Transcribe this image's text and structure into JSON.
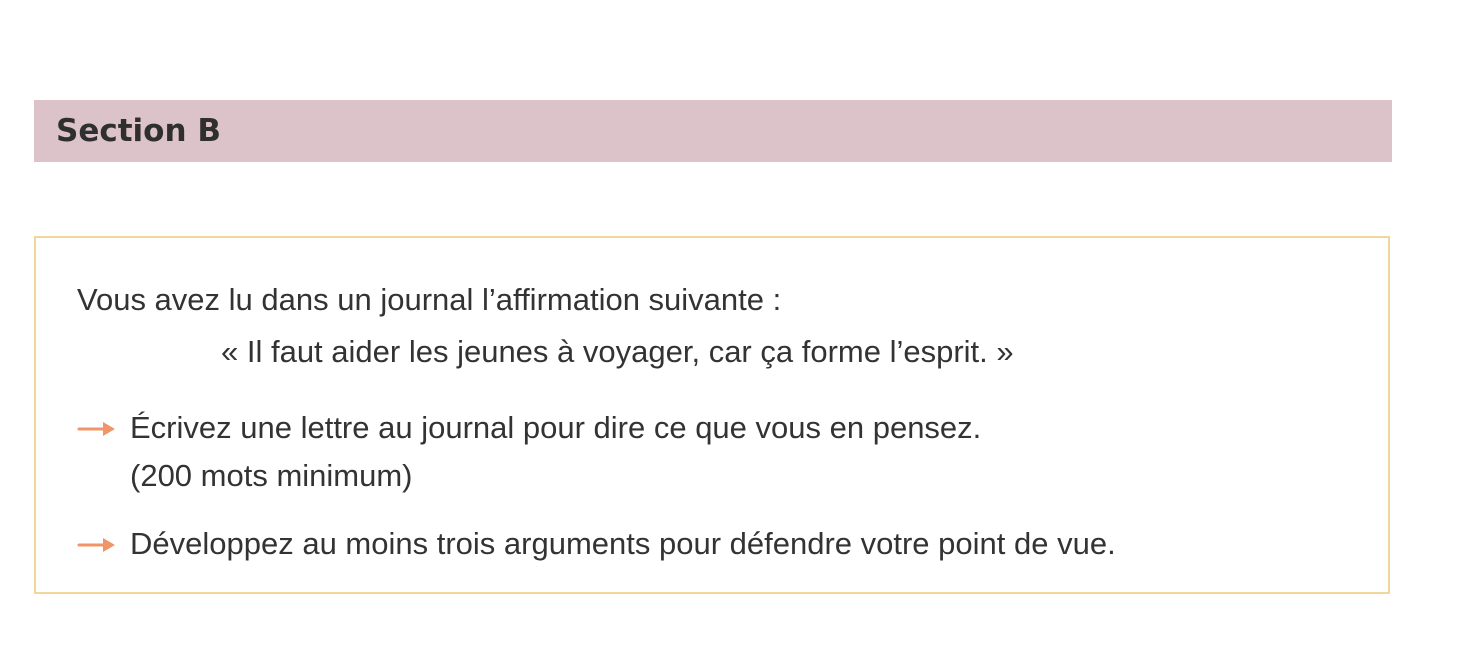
{
  "section": {
    "title": "Section B",
    "banner_color": "#dcc3ca"
  },
  "task": {
    "border_color": "#f3d79a",
    "intro": "Vous avez lu dans un journal l’affirmation suivante :",
    "quote": "« Il faut aider les jeunes à voyager, car ça forme l’esprit. »",
    "instructions": [
      {
        "icon": "arrow-right-icon",
        "text": "Écrivez une lettre au journal pour dire ce que vous en pensez.",
        "note": "(200 mots minimum)"
      },
      {
        "icon": "arrow-right-icon",
        "text": "Développez au moins trois arguments pour défendre votre point de vue."
      }
    ],
    "arrow_color": "#f0956a"
  }
}
